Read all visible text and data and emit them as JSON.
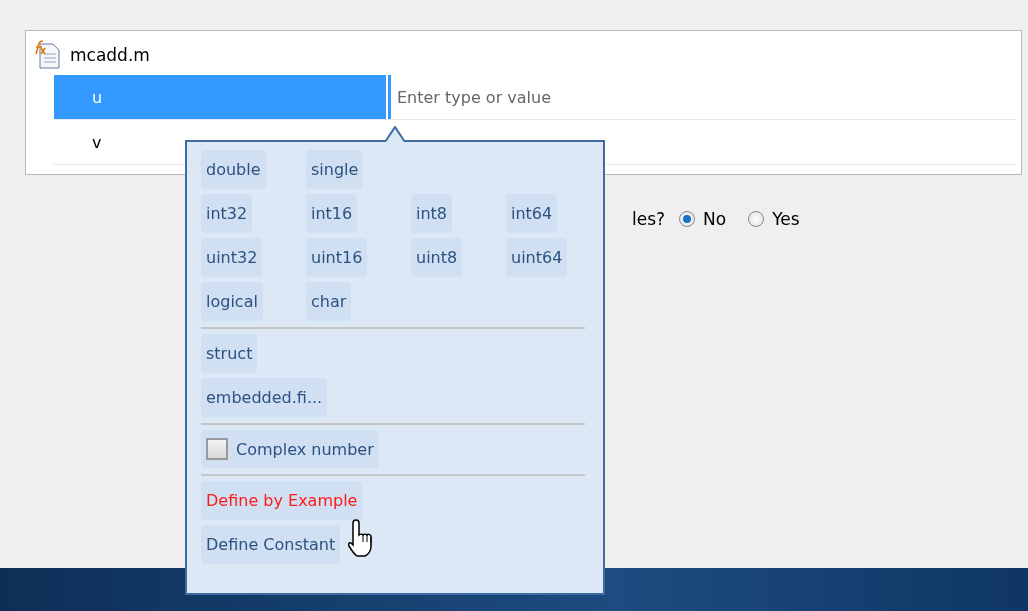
{
  "file": {
    "name": "mcadd.m"
  },
  "variables": [
    {
      "name": "u",
      "selected": true,
      "value_placeholder": "Enter type or value"
    },
    {
      "name": "v",
      "selected": false
    }
  ],
  "question": {
    "text": "les?",
    "options": [
      {
        "label": "No",
        "selected": true
      },
      {
        "label": "Yes",
        "selected": false
      }
    ]
  },
  "type_menu": {
    "type_rows": [
      [
        "double",
        "single"
      ],
      [
        "int32",
        "int16",
        "int8",
        "int64"
      ],
      [
        "uint32",
        "uint16",
        "uint8",
        "uint64"
      ],
      [
        "logical",
        "char"
      ]
    ],
    "class_items": [
      "struct",
      "embedded.fi..."
    ],
    "complex": {
      "label": "Complex number",
      "checked": false
    },
    "actions": [
      {
        "label": "Define by Example",
        "selected": true
      },
      {
        "label": "Define Constant",
        "selected": false
      }
    ]
  }
}
